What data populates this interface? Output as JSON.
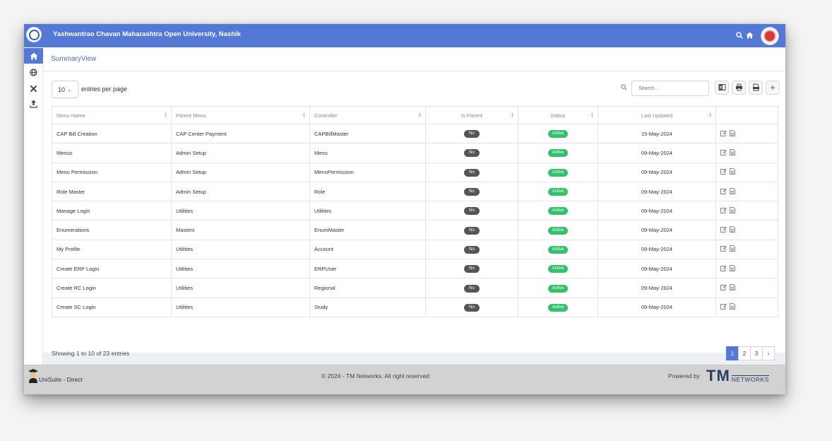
{
  "header": {
    "university_title": "Yashwantrao Chavan Maharashtra Open University, Nashik",
    "icons": [
      "search-icon",
      "home-icon"
    ],
    "accent_color": "#5478d6"
  },
  "sidebar": {
    "items": [
      {
        "name": "home-icon",
        "active": true
      },
      {
        "name": "globe-icon",
        "active": false
      },
      {
        "name": "tools-icon",
        "active": false
      },
      {
        "name": "upload-icon",
        "active": false
      }
    ]
  },
  "page": {
    "title": "SummaryView",
    "entries_value": "10",
    "entries_label": "entries per page",
    "search_placeholder": "Search..."
  },
  "table": {
    "columns": [
      "Menu Name",
      "Parent Menu",
      "Controller",
      "Is Parent",
      "Status",
      "Last Updated",
      ""
    ],
    "rows": [
      {
        "menu_name": "CAP Bill Creation",
        "parent_menu": "CAP Center Payment",
        "controller": "CAPBillMaster",
        "is_parent": "No",
        "status": "Active",
        "last_updated": "15-May-2024"
      },
      {
        "menu_name": "Menus",
        "parent_menu": "Admin Setup",
        "controller": "Menu",
        "is_parent": "No",
        "status": "Active",
        "last_updated": "09-May-2024"
      },
      {
        "menu_name": "Menu Permission",
        "parent_menu": "Admin Setup",
        "controller": "MenuPermission",
        "is_parent": "No",
        "status": "Active",
        "last_updated": "09-May-2024"
      },
      {
        "menu_name": "Role Master",
        "parent_menu": "Admin Setup",
        "controller": "Role",
        "is_parent": "No",
        "status": "Active",
        "last_updated": "09-May-2024"
      },
      {
        "menu_name": "Manage Login",
        "parent_menu": "Utilities",
        "controller": "Utilities",
        "is_parent": "No",
        "status": "Active",
        "last_updated": "09-May-2024"
      },
      {
        "menu_name": "Enumerations",
        "parent_menu": "Masters",
        "controller": "EnumMaster",
        "is_parent": "No",
        "status": "Active",
        "last_updated": "09-May-2024"
      },
      {
        "menu_name": "My Profile",
        "parent_menu": "Utilities",
        "controller": "Account",
        "is_parent": "No",
        "status": "Active",
        "last_updated": "09-May-2024"
      },
      {
        "menu_name": "Create ERP Login",
        "parent_menu": "Utilities",
        "controller": "ERPUser",
        "is_parent": "No",
        "status": "Active",
        "last_updated": "09-May-2024"
      },
      {
        "menu_name": "Create RC Login",
        "parent_menu": "Utilities",
        "controller": "Regional",
        "is_parent": "No",
        "status": "Active",
        "last_updated": "09-May-2024"
      },
      {
        "menu_name": "Create SC Login",
        "parent_menu": "Utilities",
        "controller": "Study",
        "is_parent": "No",
        "status": "Active",
        "last_updated": "09-May-2024"
      }
    ]
  },
  "pagination": {
    "showing_text": "Showing 1 to 10 of 23 entries",
    "pages": [
      "1",
      "2",
      "3",
      "›"
    ],
    "current_page": "1"
  },
  "footer": {
    "app_name": "UniSuite - Direct",
    "copyright": "© 2024 - TM Networks. All right reserved",
    "powered_by": "Powered by",
    "logo_big": "TM",
    "logo_small": "NETWORKS"
  }
}
